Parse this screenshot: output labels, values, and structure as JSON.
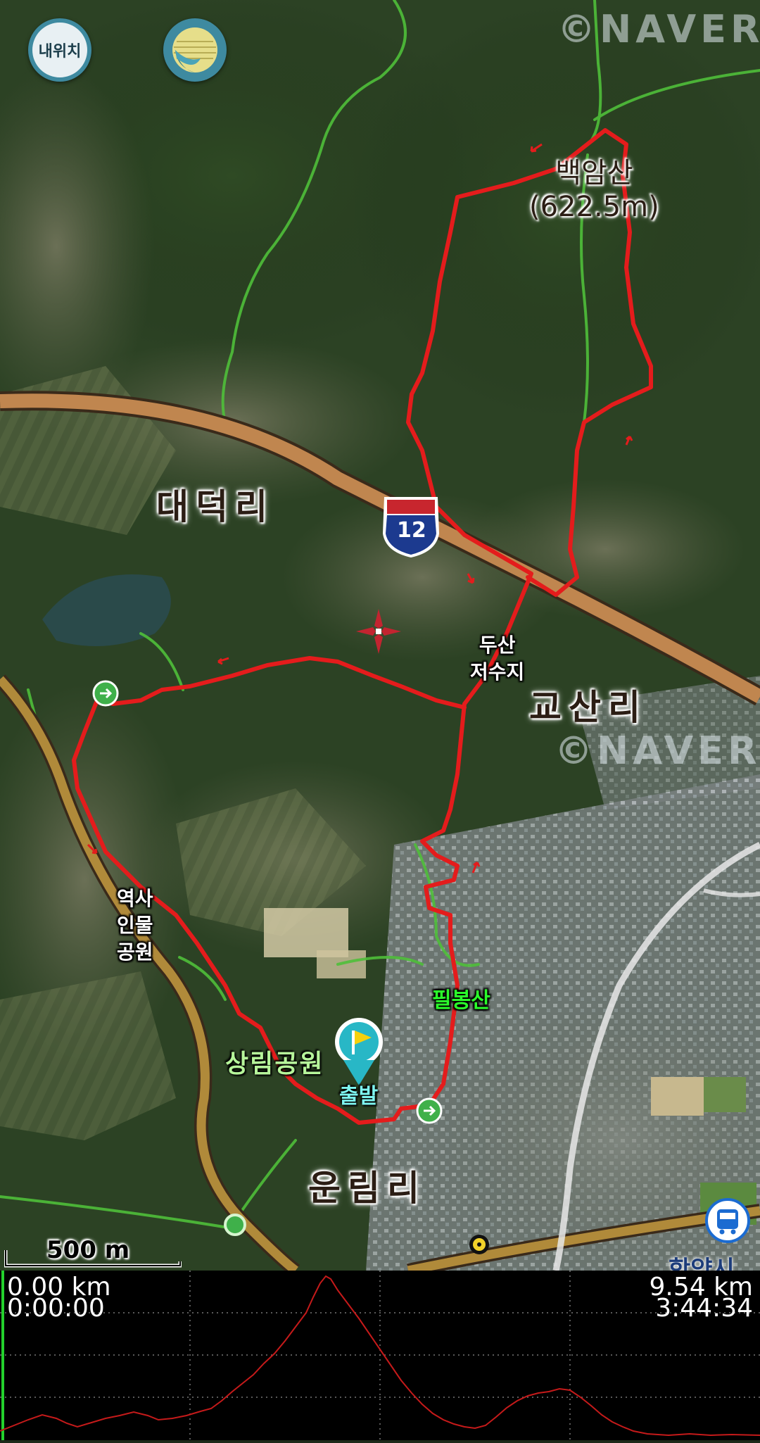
{
  "map": {
    "provider_watermark": "©NAVER",
    "place_labels": {
      "daedeok": "대덕리",
      "gyosan": "교산리",
      "unrim": "운림리"
    },
    "peak_label": {
      "name": "백암산",
      "elevation": "(622.5m)"
    },
    "highway_shield": "12",
    "waypoint_labels": {
      "dusan": [
        "두산",
        "저수지"
      ],
      "history": [
        "역사",
        "인물",
        "공원"
      ],
      "pilbong": "필봉산",
      "sangrim": "상림공원",
      "start": "출발"
    },
    "partial_label_bottom": "함양시",
    "scale": "500 m",
    "colors": {
      "track": "#e41c1c",
      "trail": "#4fbf3a",
      "highway": "#c0864f",
      "road": "#b08a3a",
      "button": "#3e8aa0"
    }
  },
  "controls": {
    "my_location": "내위치",
    "layer_icon": "layers-icon"
  },
  "elevation_profile": {
    "start_distance": "0.00 km",
    "start_time": "0:00:00",
    "end_distance": "9.54 km",
    "end_time": "3:44:34"
  }
}
